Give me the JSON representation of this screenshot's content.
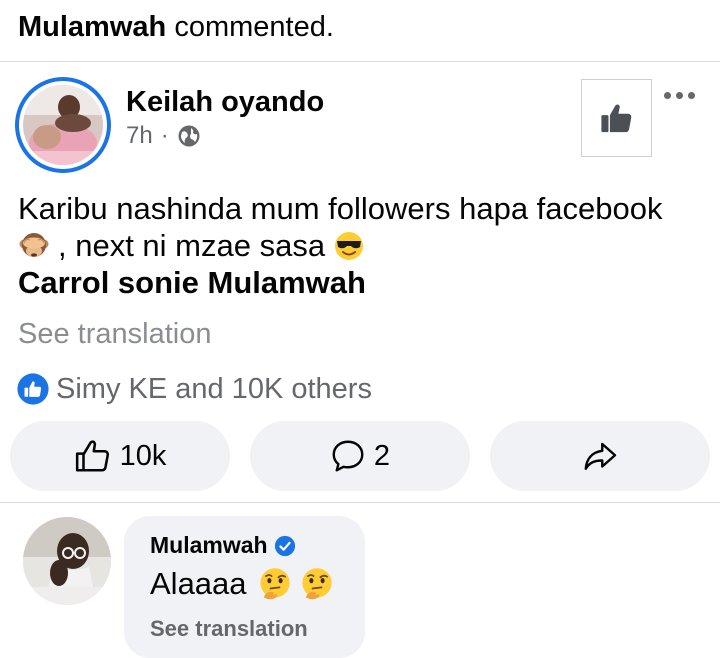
{
  "notification": {
    "actor": "Mulamwah",
    "action": "commented."
  },
  "post": {
    "author": "Keilah oyando",
    "time": "7h",
    "separator": "·",
    "line1": "Karibu nashinda mum followers hapa facebook",
    "line2": ", next ni mzae sasa",
    "line3": "Carrol sonie Mulamwah",
    "see_translation": "See translation",
    "reactions_text": "Simy KE and 10K others",
    "like_count": "10k",
    "comment_count": "2",
    "icons": {
      "privacy": "globe-icon",
      "like_page": "thumbs-up-icon",
      "menu": "more-options-icon",
      "emoji_1": "see-no-evil-monkey-emoji",
      "emoji_2": "smiling-face-with-sunglasses-emoji",
      "reaction": "like-reaction-icon",
      "like": "like-outline-icon",
      "comment": "comment-bubble-icon",
      "share": "share-arrow-icon"
    }
  },
  "comment": {
    "author": "Mulamwah",
    "verified_icon": "verified-badge-icon",
    "text": "Alaaaa",
    "emojis": [
      "thinking-face-emoji",
      "thinking-face-emoji"
    ],
    "see_translation": "See translation"
  },
  "colors": {
    "accent": "#1b74e4",
    "secondary_text": "#65676b",
    "button_bg": "#f0f2f5",
    "divider": "#dadde1"
  }
}
